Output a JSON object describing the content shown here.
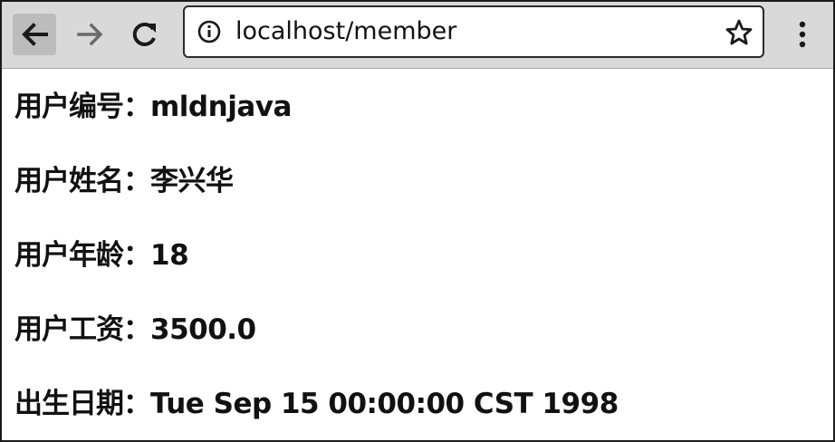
{
  "browser": {
    "url": "localhost/member",
    "icons": {
      "back": "arrow-left-icon",
      "forward": "arrow-right-icon",
      "reload": "reload-icon",
      "site_info": "info-icon",
      "bookmark": "star-icon",
      "menu": "kebab-menu-icon"
    }
  },
  "member": {
    "fields": [
      {
        "label": "用户编号：",
        "value": "mldnjava"
      },
      {
        "label": "用户姓名：",
        "value": "李兴华"
      },
      {
        "label": "用户年龄：",
        "value": "18"
      },
      {
        "label": "用户工资：",
        "value": "3500.0"
      },
      {
        "label": "出生日期：",
        "value": "Tue Sep 15 00:00:00 CST 1998"
      }
    ]
  }
}
